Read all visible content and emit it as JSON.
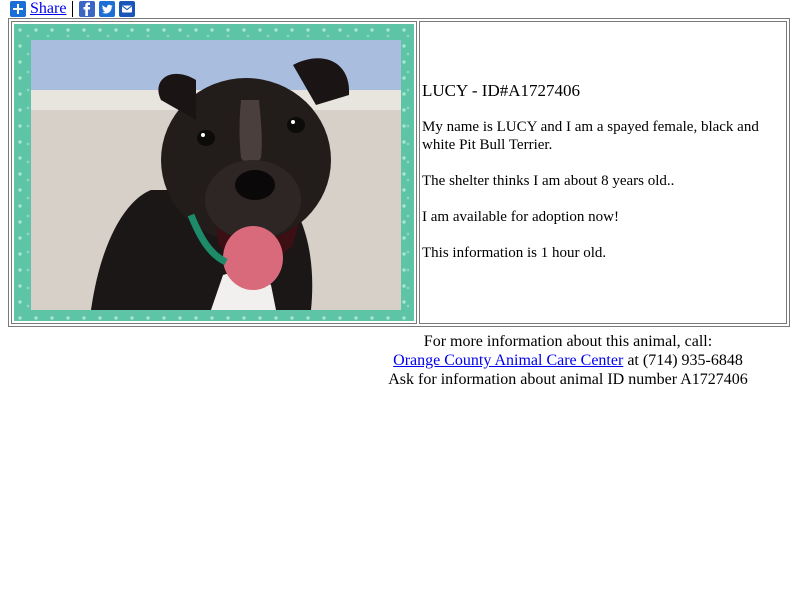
{
  "share_bar": {
    "share_label": "Share",
    "icons": [
      "facebook-icon",
      "twitter-icon",
      "email-icon"
    ],
    "colors": {
      "share": "#1a6ed8",
      "facebook": "#3b66c4",
      "twitter": "#1d6fd6",
      "email": "#1a56b8"
    }
  },
  "animal": {
    "title": "LUCY - ID#A1727406",
    "description": "My name is LUCY and I am a spayed female, black and white Pit Bull Terrier.",
    "age": "The shelter thinks I am about 8 years old..",
    "availability": "I am available for adoption now!",
    "freshness": "This information is 1 hour old.",
    "photo_frame_color": "#5ec4a6"
  },
  "footer": {
    "line1": "For more information about this animal, call:",
    "shelter_link": "Orange County Animal Care Center",
    "phone": " at (714) 935-6848",
    "line3": "Ask for information about animal ID number A1727406"
  }
}
